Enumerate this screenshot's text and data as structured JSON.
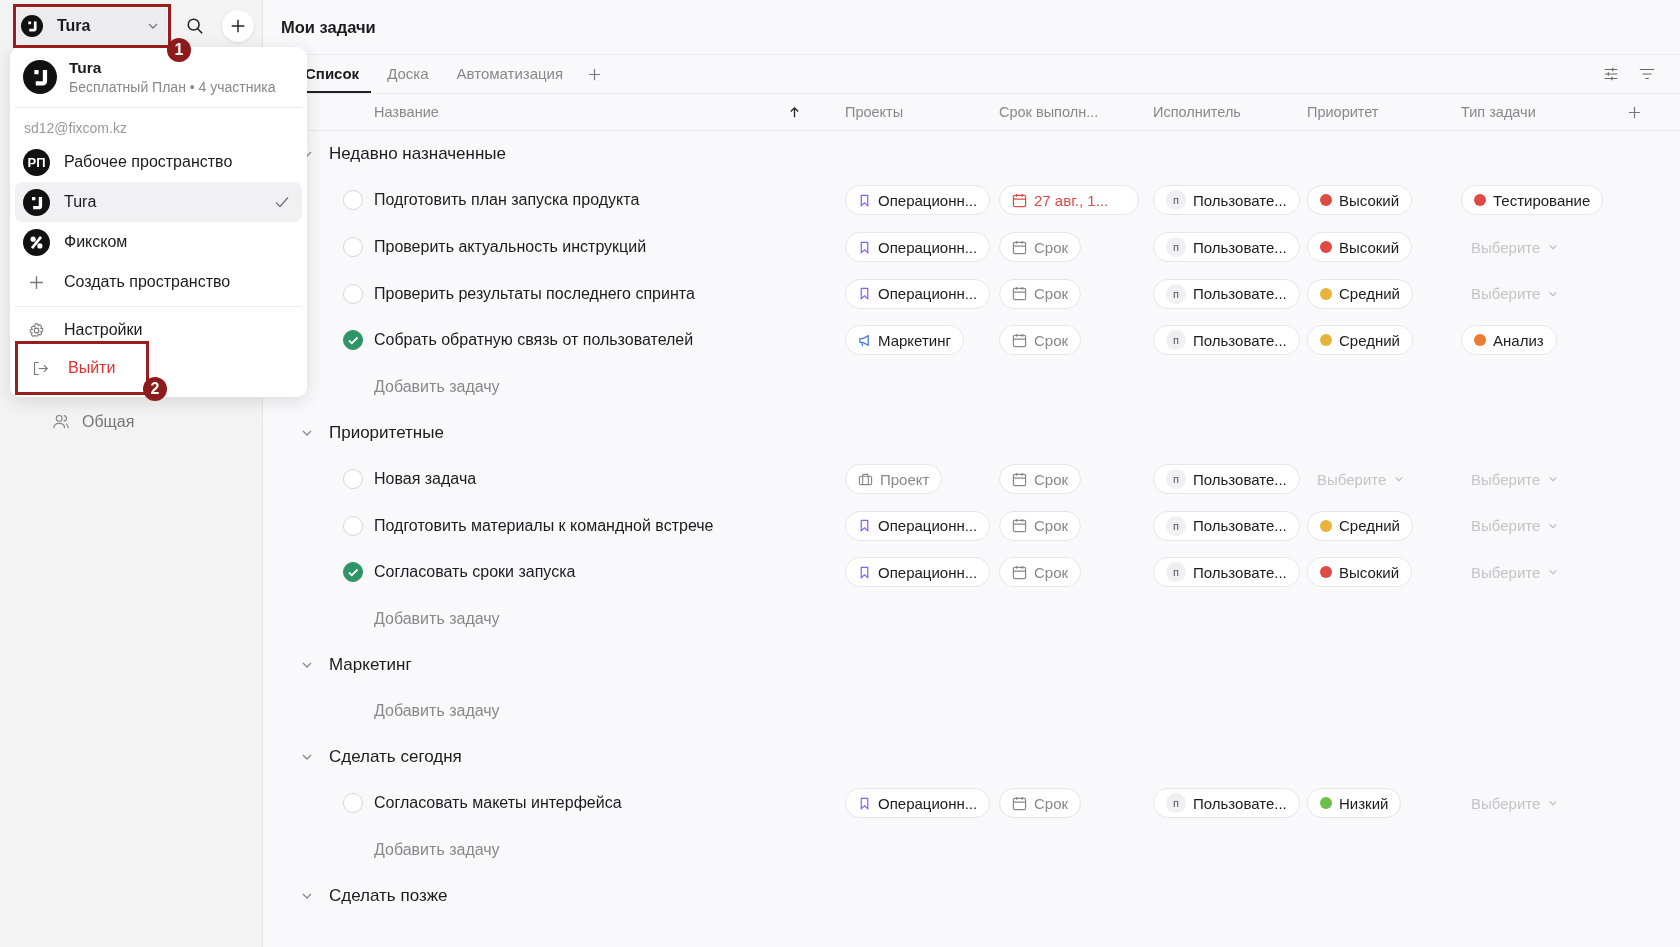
{
  "sidebar": {
    "workspace_switcher": {
      "name": "Tura",
      "annotation": "1"
    },
    "items": [
      {
        "label": "Общая"
      }
    ]
  },
  "workspace_menu": {
    "current": {
      "name": "Tura",
      "subtitle": "Бесплатный План • 4 участника"
    },
    "email": "sd12@fixcom.kz",
    "workspaces": [
      {
        "name": "Рабочее пространство",
        "kind": "initials",
        "initials": "РП",
        "selected": false
      },
      {
        "name": "Tura",
        "kind": "tura",
        "selected": true
      },
      {
        "name": "Фикском",
        "kind": "fixcom",
        "selected": false
      }
    ],
    "create_label": "Создать пространство",
    "actions": [
      {
        "kind": "settings",
        "label": "Настройки"
      },
      {
        "kind": "logout",
        "label": "Выйти",
        "annotation": "2"
      }
    ]
  },
  "page_title": "Мои задачи",
  "tabs": [
    {
      "label": "Список",
      "selected": true
    },
    {
      "label": "Доска",
      "selected": false
    },
    {
      "label": "Автоматизация",
      "selected": false
    }
  ],
  "columns": [
    "Название",
    "Проекты",
    "Срок выполн...",
    "Исполнитель",
    "Приоритет",
    "Тип задачи"
  ],
  "groups": [
    {
      "title": "Недавно назначенные",
      "add_label": "Добавить задачу",
      "tasks": [
        {
          "title": "Подготовить план запуска продукта",
          "done": false,
          "project": {
            "kind": "bookmark",
            "label": "Операционн..."
          },
          "due": {
            "label": "27 авг., 1...",
            "overdue": true
          },
          "assignee": {
            "initial": "п",
            "label": "Пользовате..."
          },
          "priority": {
            "kind": "value",
            "label": "Высокий",
            "color": "#e04a45"
          },
          "type": {
            "kind": "value",
            "label": "Тестирование",
            "color": "#e04a45"
          }
        },
        {
          "title": "Проверить актуальность инструкций",
          "done": false,
          "project": {
            "kind": "bookmark",
            "label": "Операционн..."
          },
          "due": {
            "label": "Срок",
            "overdue": false
          },
          "assignee": {
            "initial": "п",
            "label": "Пользовате..."
          },
          "priority": {
            "kind": "value",
            "label": "Высокий",
            "color": "#e04a45"
          },
          "type": {
            "kind": "select",
            "label": "Выберите"
          }
        },
        {
          "title": "Проверить результаты последнего спринта",
          "done": false,
          "project": {
            "kind": "bookmark",
            "label": "Операционн..."
          },
          "due": {
            "label": "Срок",
            "overdue": false
          },
          "assignee": {
            "initial": "п",
            "label": "Пользовате..."
          },
          "priority": {
            "kind": "value",
            "label": "Средний",
            "color": "#e6b43a"
          },
          "type": {
            "kind": "select",
            "label": "Выберите"
          }
        },
        {
          "title": "Собрать обратную связь от пользователей",
          "done": true,
          "project": {
            "kind": "megaphone",
            "label": "Маркетинг"
          },
          "due": {
            "label": "Срок",
            "overdue": false
          },
          "assignee": {
            "initial": "п",
            "label": "Пользовате..."
          },
          "priority": {
            "kind": "value",
            "label": "Средний",
            "color": "#e6b43a"
          },
          "type": {
            "kind": "value",
            "label": "Анализ",
            "color": "#ec7a32"
          }
        }
      ]
    },
    {
      "title": "Приоритетные",
      "add_label": "Добавить задачу",
      "tasks": [
        {
          "title": "Новая задача",
          "done": false,
          "project": {
            "kind": "empty",
            "label": "Проект"
          },
          "due": {
            "label": "Срок",
            "overdue": false
          },
          "assignee": {
            "initial": "п",
            "label": "Пользовате..."
          },
          "priority": {
            "kind": "select",
            "label": "Выберите"
          },
          "type": {
            "kind": "select",
            "label": "Выберите"
          }
        },
        {
          "title": "Подготовить материалы к командной встрече",
          "done": false,
          "project": {
            "kind": "bookmark",
            "label": "Операционн..."
          },
          "due": {
            "label": "Срок",
            "overdue": false
          },
          "assignee": {
            "initial": "п",
            "label": "Пользовате..."
          },
          "priority": {
            "kind": "value",
            "label": "Средний",
            "color": "#e6b43a"
          },
          "type": {
            "kind": "select",
            "label": "Выберите"
          }
        },
        {
          "title": "Согласовать сроки запуска",
          "done": true,
          "project": {
            "kind": "bookmark",
            "label": "Операционн..."
          },
          "due": {
            "label": "Срок",
            "overdue": false
          },
          "assignee": {
            "initial": "п",
            "label": "Пользовате..."
          },
          "priority": {
            "kind": "value",
            "label": "Высокий",
            "color": "#e04a45"
          },
          "type": {
            "kind": "select",
            "label": "Выберите"
          }
        }
      ]
    },
    {
      "title": "Маркетинг",
      "add_label": "Добавить задачу"
    },
    {
      "title": "Сделать сегодня",
      "add_label": "Добавить задачу",
      "tasks": [
        {
          "title": "Согласовать макеты интерфейса",
          "done": false,
          "project": {
            "kind": "bookmark",
            "label": "Операционн..."
          },
          "due": {
            "label": "Срок",
            "overdue": false
          },
          "assignee": {
            "initial": "п",
            "label": "Пользовате..."
          },
          "priority": {
            "kind": "value",
            "label": "Низкий",
            "color": "#6cc04a"
          },
          "type": {
            "kind": "select",
            "label": "Выберите"
          }
        }
      ]
    },
    {
      "title": "Сделать позже"
    }
  ]
}
